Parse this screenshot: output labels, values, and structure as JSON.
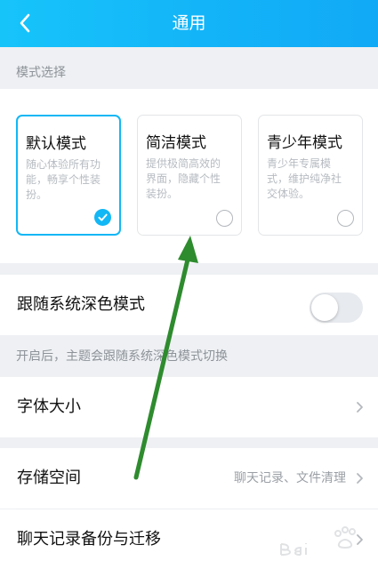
{
  "header": {
    "title": "通用",
    "background": "#12b7f5"
  },
  "mode_section": {
    "label": "模式选择",
    "cards": [
      {
        "title": "默认模式",
        "description": "随心体验所有功能，畅享个性装扮。",
        "selected": true
      },
      {
        "title": "简洁模式",
        "description": "提供极简高效的界面，隐藏个性装扮。",
        "selected": false
      },
      {
        "title": "青少年模式",
        "description": "青少年专属模式，维护纯净社交体验。",
        "selected": false
      }
    ]
  },
  "dark_mode": {
    "label": "跟随系统深色模式",
    "enabled": false,
    "hint": "开启后，主题会跟随系统深色模式切换"
  },
  "font_size": {
    "label": "字体大小"
  },
  "storage": {
    "label": "存储空间",
    "value": "聊天记录、文件清理"
  },
  "backup": {
    "label": "聊天记录备份与迁移"
  },
  "colors": {
    "accent": "#12b7f5",
    "annotation_arrow": "#2e8b2e"
  },
  "icons": [
    "back-arrow-icon",
    "checkmark-icon",
    "chevron-right-icon",
    "annotation-arrow",
    "baidu-watermark"
  ]
}
